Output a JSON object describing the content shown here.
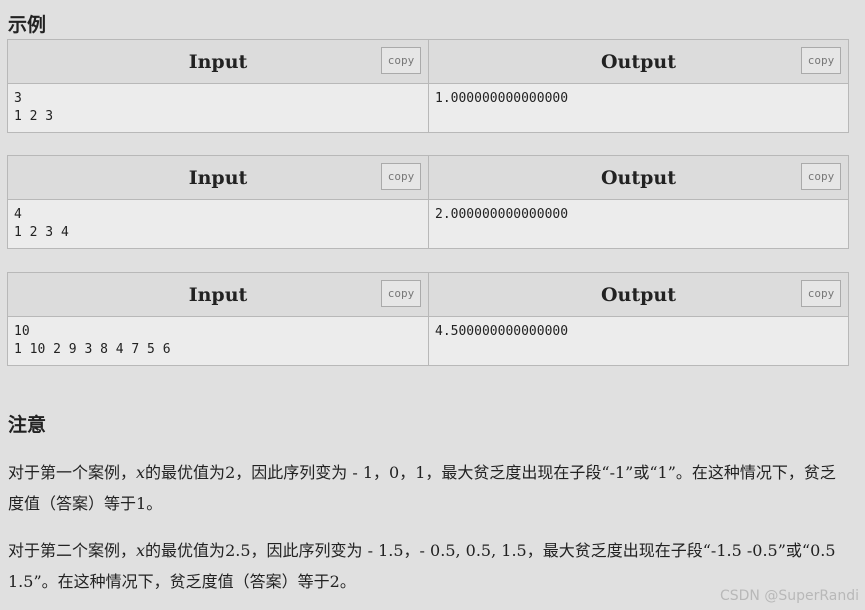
{
  "examples_title": "示例",
  "samples": [
    {
      "input_label": "Input",
      "output_label": "Output",
      "copy_label": "copy",
      "input_text": "3\n1 2 3",
      "output_text": "1.000000000000000"
    },
    {
      "input_label": "Input",
      "output_label": "Output",
      "copy_label": "copy",
      "input_text": "4\n1 2 3 4",
      "output_text": "2.000000000000000"
    },
    {
      "input_label": "Input",
      "output_label": "Output",
      "copy_label": "copy",
      "input_text": "10\n1 10 2 9 3 8 4 7 5 6",
      "output_text": "4.500000000000000"
    }
  ],
  "notes_title": "注意",
  "note1": {
    "p1": "对于第一个案例，",
    "var": "x",
    "p2": "的最优值为",
    "val": "2",
    "p3": "，因此序列变为",
    "seq": " - 1，0，1，",
    "p4": "最大贫乏度出现在子段",
    "q1": "“-1”",
    "p5": "或",
    "q2": "“1”",
    "p6": "。在这种情况下，贫乏度值（答案）等于",
    "ans": "1",
    "p7": "。"
  },
  "note2": {
    "p1": "对于第二个案例，",
    "var": "x",
    "p2": "的最优值为",
    "val": "2.5",
    "p3": "，因此序列变为",
    "seq": " - 1.5，- 0.5, 0.5, 1.5，",
    "p4": "最大贫乏度出现在子段",
    "q1": "“-1.5 -0.5”",
    "p5": "或",
    "q2": "“0.5 1.5”",
    "p6": "。在这种情况下，贫乏度值（答案）等于",
    "ans": "2",
    "p7": "。"
  },
  "watermark": "CSDN @SuperRandi"
}
